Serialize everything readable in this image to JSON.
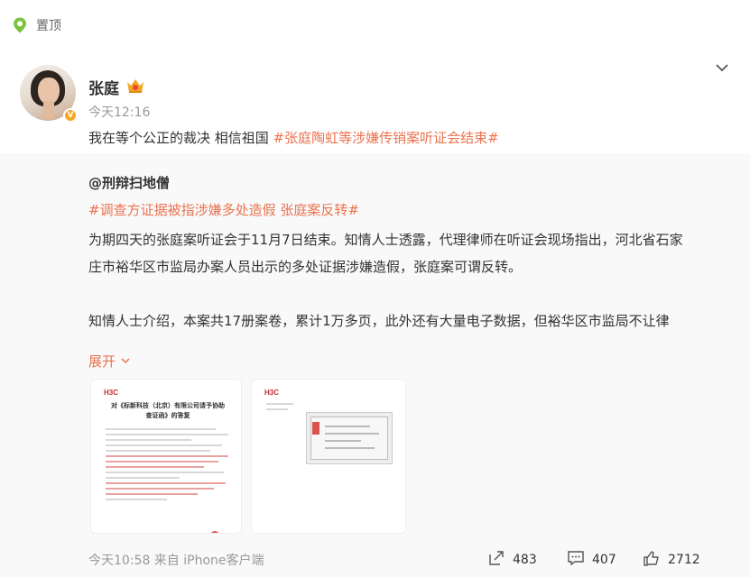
{
  "pinned": {
    "icon": "location-pin-icon",
    "label": "置顶"
  },
  "post": {
    "user_name": "张庭",
    "time": "今天12:16",
    "text_prefix": "我在等个公正的裁决 相信祖国 ",
    "hashtag": "#张庭陶虹等涉嫌传销案听证会结束#",
    "accent_color": "#eb7350"
  },
  "repost": {
    "author": "@刑辩扫地僧",
    "tags": "#调查方证据被指涉嫌多处造假 张庭案反转#",
    "body_line1": "为期四天的张庭案听证会于11月7日结束。知情人士透露，代理律师在听证会现场指出，河北省石家",
    "body_line2": "庄市裕华区市监局办案人员出示的多处证据涉嫌造假，张庭案可谓反转。",
    "body_line3": "知情人士介绍，本案共17册案卷，累计1万多页，此外还有大量电子数据，但裕华区市监局不让律",
    "expand_label": "展开",
    "images": [
      {
        "logo": "H3C",
        "title": "对《标新科技（北京）有限公司请予协助查证函》的答复"
      },
      {
        "logo": "H3C"
      }
    ],
    "footer_time": "今天10:58 来自 iPhone客户端",
    "repost_count": "483",
    "comment_count": "407",
    "like_count": "2712"
  }
}
